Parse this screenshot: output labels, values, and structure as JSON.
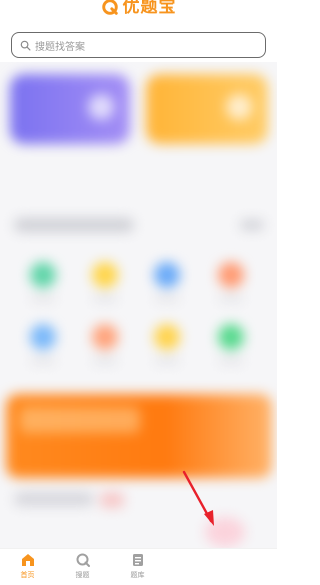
{
  "app": {
    "title": "优题宝",
    "brand_color": "#f7941e"
  },
  "search": {
    "placeholder": "搜题找答案",
    "icon": "search-icon"
  },
  "nav": {
    "items": [
      {
        "label": "首页",
        "icon": "home-icon",
        "active": true
      },
      {
        "label": "搜题",
        "icon": "search-tab-icon",
        "active": false
      },
      {
        "label": "题库",
        "icon": "question-bank-icon",
        "active": false
      }
    ]
  },
  "colors": {
    "banner_purple": "#7b72f0",
    "banner_orange": "#ffb437",
    "promo_orange": "#ff8a1f",
    "arrow_red": "#e8212b"
  }
}
